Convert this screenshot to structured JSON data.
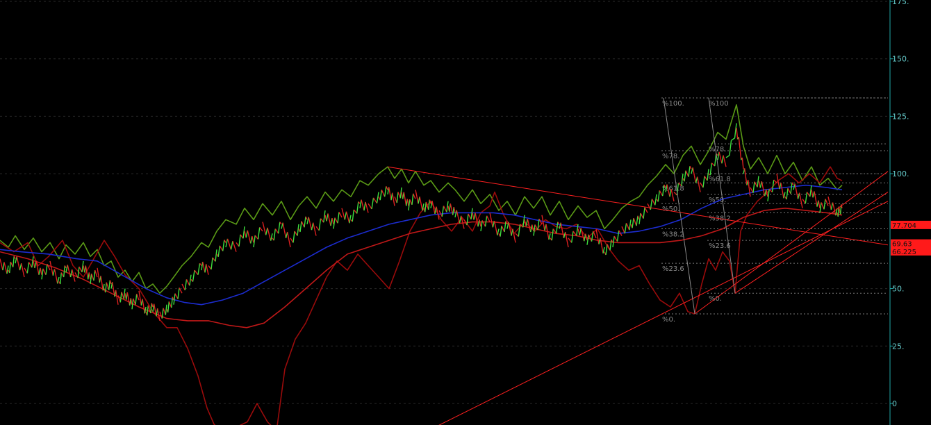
{
  "chart_data": {
    "type": "line",
    "title": "",
    "xlabel": "",
    "ylabel": "",
    "y_axis_side": "right",
    "ylim": [
      0,
      175
    ],
    "y_ticks": [
      {
        "value": 175,
        "label": "175."
      },
      {
        "value": 150,
        "label": "150."
      },
      {
        "value": 125,
        "label": "125."
      },
      {
        "value": 100,
        "label": "100."
      },
      {
        "value": 50,
        "label": "50."
      },
      {
        "value": 25,
        "label": "25."
      },
      {
        "value": 0,
        "label": "0"
      }
    ],
    "grid": "horizontal-dashed",
    "price_tags": [
      {
        "value": 77.704,
        "label": "77.704",
        "color": "#ff1a1a"
      },
      {
        "value": 69.63,
        "label": "69.63",
        "color": "#ff1a1a"
      },
      {
        "value": 66.225,
        "label": "66.225",
        "color": "#ff1a1a"
      }
    ],
    "fibonacci_sets": [
      {
        "levels": [
          {
            "label": "%100.",
            "value": 133
          },
          {
            "label": "%78.",
            "value": 110
          },
          {
            "label": "%61.8",
            "value": 96
          },
          {
            "label": "%50.",
            "value": 87
          },
          {
            "label": "%38.2",
            "value": 76
          },
          {
            "label": "%23.6",
            "value": 61
          },
          {
            "label": "%0.",
            "value": 39
          }
        ]
      },
      {
        "levels": [
          {
            "label": "%100",
            "value": 133
          },
          {
            "label": "%78.",
            "value": 113
          },
          {
            "label": "%61.8",
            "value": 100
          },
          {
            "label": "%50.",
            "value": 91
          },
          {
            "label": "%38.2",
            "value": 83
          },
          {
            "label": "%23.6",
            "value": 71
          },
          {
            "label": "%0.",
            "value": 48
          }
        ]
      }
    ],
    "series": [
      {
        "color": "#5a9a16",
        "kind": "upper-envelope",
        "values": [
          [
            0,
            71
          ],
          [
            12,
            68
          ],
          [
            22,
            73
          ],
          [
            35,
            67
          ],
          [
            48,
            72
          ],
          [
            60,
            66
          ],
          [
            72,
            70
          ],
          [
            85,
            63
          ],
          [
            95,
            69
          ],
          [
            108,
            65
          ],
          [
            120,
            70
          ],
          [
            130,
            64
          ],
          [
            140,
            67
          ],
          [
            150,
            60
          ],
          [
            160,
            62
          ],
          [
            170,
            55
          ],
          [
            180,
            58
          ],
          [
            190,
            53
          ],
          [
            200,
            57
          ],
          [
            210,
            50
          ],
          [
            220,
            52
          ],
          [
            230,
            48
          ],
          [
            240,
            51
          ],
          [
            250,
            55
          ],
          [
            262,
            60
          ],
          [
            275,
            64
          ],
          [
            290,
            70
          ],
          [
            300,
            68
          ],
          [
            312,
            75
          ],
          [
            325,
            80
          ],
          [
            340,
            78
          ],
          [
            352,
            85
          ],
          [
            365,
            80
          ],
          [
            378,
            87
          ],
          [
            392,
            82
          ],
          [
            405,
            88
          ],
          [
            418,
            80
          ],
          [
            430,
            86
          ],
          [
            442,
            90
          ],
          [
            455,
            85
          ],
          [
            468,
            92
          ],
          [
            480,
            88
          ],
          [
            492,
            93
          ],
          [
            505,
            90
          ],
          [
            518,
            97
          ],
          [
            530,
            95
          ],
          [
            545,
            100
          ],
          [
            558,
            103
          ],
          [
            568,
            98
          ],
          [
            578,
            102
          ],
          [
            588,
            96
          ],
          [
            598,
            101
          ],
          [
            610,
            95
          ],
          [
            620,
            97
          ],
          [
            632,
            92
          ],
          [
            645,
            96
          ],
          [
            655,
            93
          ],
          [
            668,
            88
          ],
          [
            680,
            93
          ],
          [
            692,
            87
          ],
          [
            705,
            91
          ],
          [
            718,
            84
          ],
          [
            730,
            88
          ],
          [
            742,
            82
          ],
          [
            755,
            90
          ],
          [
            768,
            85
          ],
          [
            780,
            90
          ],
          [
            792,
            82
          ],
          [
            805,
            88
          ],
          [
            818,
            80
          ],
          [
            832,
            86
          ],
          [
            845,
            81
          ],
          [
            858,
            84
          ],
          [
            870,
            76
          ],
          [
            882,
            80
          ],
          [
            895,
            85
          ],
          [
            908,
            88
          ],
          [
            920,
            90
          ],
          [
            932,
            95
          ],
          [
            945,
            99
          ],
          [
            958,
            104
          ],
          [
            970,
            100
          ],
          [
            983,
            108
          ],
          [
            995,
            112
          ],
          [
            1008,
            104
          ],
          [
            1020,
            110
          ],
          [
            1033,
            118
          ],
          [
            1045,
            115
          ],
          [
            1060,
            130
          ],
          [
            1070,
            112
          ],
          [
            1080,
            102
          ],
          [
            1092,
            107
          ],
          [
            1105,
            100
          ],
          [
            1118,
            108
          ],
          [
            1130,
            100
          ],
          [
            1142,
            105
          ],
          [
            1155,
            97
          ],
          [
            1168,
            103
          ],
          [
            1180,
            95
          ],
          [
            1192,
            98
          ],
          [
            1205,
            93
          ],
          [
            1212,
            95
          ]
        ]
      },
      {
        "color": "#9a0b0b",
        "kind": "indicator-line",
        "values": [
          [
            0,
            70
          ],
          [
            20,
            66
          ],
          [
            40,
            70
          ],
          [
            55,
            60
          ],
          [
            70,
            64
          ],
          [
            90,
            71
          ],
          [
            105,
            60
          ],
          [
            120,
            55
          ],
          [
            135,
            63
          ],
          [
            150,
            71
          ],
          [
            165,
            64
          ],
          [
            180,
            56
          ],
          [
            200,
            50
          ],
          [
            220,
            40
          ],
          [
            240,
            33
          ],
          [
            255,
            33
          ],
          [
            270,
            24
          ],
          [
            285,
            12
          ],
          [
            298,
            -2
          ],
          [
            308,
            -9
          ],
          [
            318,
            -12
          ],
          [
            330,
            -14
          ],
          [
            342,
            -10
          ],
          [
            356,
            -8
          ],
          [
            370,
            0
          ],
          [
            385,
            -8
          ],
          [
            398,
            -12
          ],
          [
            410,
            15
          ],
          [
            425,
            28
          ],
          [
            440,
            35
          ],
          [
            455,
            45
          ],
          [
            470,
            55
          ],
          [
            485,
            62
          ],
          [
            500,
            58
          ],
          [
            515,
            65
          ],
          [
            530,
            60
          ],
          [
            545,
            55
          ],
          [
            560,
            50
          ],
          [
            575,
            62
          ],
          [
            590,
            75
          ],
          [
            605,
            83
          ],
          [
            620,
            88
          ],
          [
            635,
            80
          ],
          [
            650,
            75
          ],
          [
            665,
            81
          ],
          [
            680,
            75
          ],
          [
            692,
            83
          ],
          [
            705,
            86
          ],
          [
            712,
            92
          ],
          [
            725,
            82
          ],
          [
            740,
            74
          ],
          [
            755,
            79
          ],
          [
            770,
            75
          ],
          [
            785,
            80
          ],
          [
            800,
            77
          ],
          [
            815,
            76
          ],
          [
            830,
            78
          ],
          [
            845,
            72
          ],
          [
            860,
            76
          ],
          [
            875,
            68
          ],
          [
            890,
            62
          ],
          [
            905,
            58
          ],
          [
            920,
            60
          ],
          [
            935,
            52
          ],
          [
            950,
            45
          ],
          [
            965,
            42
          ],
          [
            978,
            48
          ],
          [
            990,
            40
          ],
          [
            1000,
            39
          ],
          [
            1010,
            52
          ],
          [
            1020,
            63
          ],
          [
            1030,
            58
          ],
          [
            1040,
            66
          ],
          [
            1050,
            62
          ],
          [
            1058,
            48
          ],
          [
            1066,
            75
          ],
          [
            1075,
            82
          ],
          [
            1090,
            88
          ],
          [
            1105,
            92
          ],
          [
            1120,
            97
          ],
          [
            1135,
            100
          ],
          [
            1150,
            96
          ],
          [
            1165,
            100
          ],
          [
            1180,
            96
          ],
          [
            1195,
            103
          ],
          [
            1205,
            98
          ],
          [
            1212,
            97
          ]
        ]
      },
      {
        "color": "#1c2ccf",
        "kind": "moving-average",
        "values": [
          [
            0,
            67
          ],
          [
            30,
            66
          ],
          [
            70,
            65
          ],
          [
            110,
            63
          ],
          [
            140,
            62
          ],
          [
            175,
            56
          ],
          [
            210,
            50
          ],
          [
            240,
            46
          ],
          [
            265,
            44
          ],
          [
            290,
            43
          ],
          [
            320,
            45
          ],
          [
            350,
            48
          ],
          [
            380,
            53
          ],
          [
            410,
            58
          ],
          [
            440,
            63
          ],
          [
            470,
            68
          ],
          [
            500,
            72
          ],
          [
            530,
            75
          ],
          [
            560,
            78
          ],
          [
            590,
            80
          ],
          [
            620,
            82
          ],
          [
            650,
            83
          ],
          [
            680,
            83
          ],
          [
            710,
            83
          ],
          [
            740,
            82
          ],
          [
            770,
            80
          ],
          [
            800,
            78
          ],
          [
            830,
            77
          ],
          [
            860,
            76
          ],
          [
            890,
            74
          ],
          [
            920,
            75
          ],
          [
            950,
            77
          ],
          [
            980,
            80
          ],
          [
            1010,
            85
          ],
          [
            1040,
            89
          ],
          [
            1070,
            91
          ],
          [
            1100,
            93
          ],
          [
            1130,
            94
          ],
          [
            1160,
            95
          ],
          [
            1190,
            94
          ],
          [
            1212,
            93
          ]
        ]
      },
      {
        "color": "#c01818",
        "kind": "slow-moving-average",
        "values": [
          [
            0,
            66
          ],
          [
            40,
            63
          ],
          [
            80,
            59
          ],
          [
            120,
            54
          ],
          [
            160,
            48
          ],
          [
            200,
            42
          ],
          [
            240,
            37
          ],
          [
            270,
            36
          ],
          [
            300,
            36
          ],
          [
            330,
            34
          ],
          [
            355,
            33
          ],
          [
            380,
            35
          ],
          [
            410,
            42
          ],
          [
            440,
            50
          ],
          [
            470,
            58
          ],
          [
            500,
            65
          ],
          [
            530,
            68
          ],
          [
            560,
            71
          ],
          [
            590,
            74
          ],
          [
            620,
            76
          ],
          [
            650,
            78
          ],
          [
            680,
            79
          ],
          [
            710,
            79
          ],
          [
            740,
            78
          ],
          [
            770,
            76
          ],
          [
            800,
            74
          ],
          [
            830,
            73
          ],
          [
            860,
            71
          ],
          [
            890,
            70
          ],
          [
            920,
            70
          ],
          [
            950,
            70
          ],
          [
            980,
            71
          ],
          [
            1010,
            73
          ],
          [
            1040,
            76
          ],
          [
            1070,
            81
          ],
          [
            1100,
            84
          ],
          [
            1130,
            85
          ],
          [
            1160,
            84
          ],
          [
            1190,
            83
          ],
          [
            1212,
            82
          ]
        ]
      }
    ],
    "trendlines": [
      {
        "color": "#ff2020",
        "points": [
          [
            558,
            103
          ],
          [
            1278,
            69
          ]
        ]
      },
      {
        "color": "#ff2020",
        "points": [
          [
            575,
            -18
          ],
          [
            1278,
            88
          ]
        ]
      },
      {
        "color": "#ff2020",
        "points": [
          [
            1000,
            39
          ],
          [
            1278,
            101
          ]
        ]
      },
      {
        "color": "#ff2020",
        "points": [
          [
            1058,
            48
          ],
          [
            1278,
            92
          ]
        ]
      },
      {
        "color": "#8a8a8a",
        "points": [
          [
            955,
            133
          ],
          [
            1000,
            39
          ]
        ]
      },
      {
        "color": "#8a8a8a",
        "points": [
          [
            1020,
            133
          ],
          [
            1058,
            48
          ]
        ]
      }
    ]
  }
}
